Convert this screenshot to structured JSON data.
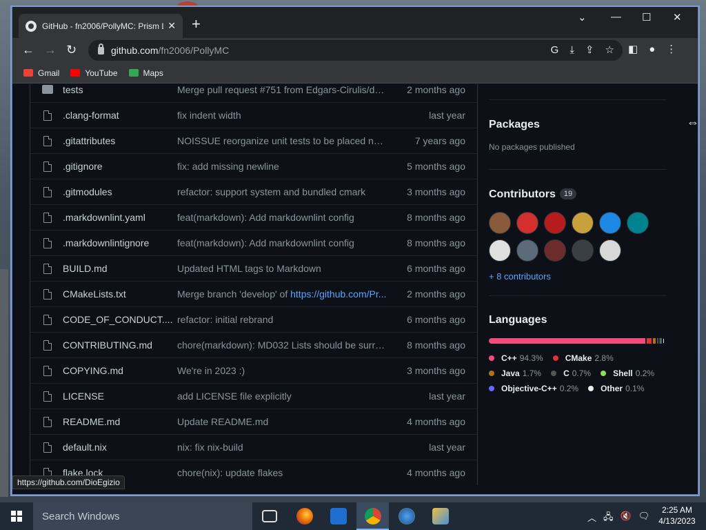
{
  "browser": {
    "tab_title": "GitHub - fn2006/PollyMC: Prism L",
    "tab_close": "✕",
    "new_tab": "+",
    "url_host": "github.com",
    "url_path": "/fn2006/PollyMC",
    "bookmarks": [
      {
        "label": "Gmail",
        "icon": "gmail-icon",
        "color": "#ea4335"
      },
      {
        "label": "YouTube",
        "icon": "youtube-icon",
        "color": "#ff0000"
      },
      {
        "label": "Maps",
        "icon": "maps-icon",
        "color": "#34a853"
      }
    ],
    "status_url": "https://github.com/DioEgizio"
  },
  "files": [
    {
      "type": "folder",
      "name": "tests",
      "message": "Merge pull request #751 from Edgars-Cirulis/dev...",
      "age": "2 months ago"
    },
    {
      "type": "file",
      "name": ".clang-format",
      "message": "fix indent width",
      "age": "last year"
    },
    {
      "type": "file",
      "name": ".gitattributes",
      "message": "NOISSUE reorganize unit tests to be placed next ...",
      "age": "7 years ago"
    },
    {
      "type": "file",
      "name": ".gitignore",
      "message": "fix: add missing newline",
      "age": "5 months ago"
    },
    {
      "type": "file",
      "name": ".gitmodules",
      "message": "refactor: support system and bundled cmark",
      "age": "3 months ago"
    },
    {
      "type": "file",
      "name": ".markdownlint.yaml",
      "message": "feat(markdown): Add markdownlint config",
      "age": "8 months ago"
    },
    {
      "type": "file",
      "name": ".markdownlintignore",
      "message": "feat(markdown): Add markdownlint config",
      "age": "8 months ago"
    },
    {
      "type": "file",
      "name": "BUILD.md",
      "message": "Updated HTML tags to Markdown",
      "age": "6 months ago"
    },
    {
      "type": "file",
      "name": "CMakeLists.txt",
      "message": "Merge branch 'develop' of ",
      "link": "https://github.com/Pr...",
      "age": "2 months ago"
    },
    {
      "type": "file",
      "name": "CODE_OF_CONDUCT....",
      "message": "refactor: initial rebrand",
      "age": "6 months ago"
    },
    {
      "type": "file",
      "name": "CONTRIBUTING.md",
      "message": "chore(markdown): MD032 Lists should be surrou...",
      "age": "8 months ago"
    },
    {
      "type": "file",
      "name": "COPYING.md",
      "message": "We're in 2023 :)",
      "age": "3 months ago"
    },
    {
      "type": "file",
      "name": "LICENSE",
      "message": "add LICENSE file explicitly",
      "age": "last year"
    },
    {
      "type": "file",
      "name": "README.md",
      "message": "Update README.md",
      "age": "4 months ago"
    },
    {
      "type": "file",
      "name": "default.nix",
      "message": "nix: fix nix-build",
      "age": "last year"
    },
    {
      "type": "file",
      "name": "flake.lock",
      "message": "chore(nix): update flakes",
      "age": "4 months ago"
    }
  ],
  "sidebar": {
    "packages_title": "Packages",
    "packages_empty": "No packages published",
    "contributors_title": "Contributors",
    "contributors_count": "19",
    "avatar_colors": [
      "#8a5a3c",
      "#d32f2f",
      "#b71c1c",
      "#c8a03c",
      "#1e88e5",
      "#00838f",
      "#e0e0e0",
      "#5c6b7a",
      "#6d2c2c",
      "#3a3f44",
      "#d8d8d8"
    ],
    "more_contributors": "+ 8 contributors",
    "languages_title": "Languages",
    "languages": [
      {
        "name": "C++",
        "pct": "94.3%",
        "share": 94.3,
        "color": "#f34b7d"
      },
      {
        "name": "CMake",
        "pct": "2.8%",
        "share": 2.8,
        "color": "#da3434"
      },
      {
        "name": "Java",
        "pct": "1.7%",
        "share": 1.7,
        "color": "#b07219"
      },
      {
        "name": "C",
        "pct": "0.7%",
        "share": 0.7,
        "color": "#555555"
      },
      {
        "name": "Shell",
        "pct": "0.2%",
        "share": 0.2,
        "color": "#89e051"
      },
      {
        "name": "Objective-C++",
        "pct": "0.2%",
        "share": 0.2,
        "color": "#6866fb"
      },
      {
        "name": "Other",
        "pct": "0.1%",
        "share": 0.1,
        "color": "#ededed"
      }
    ]
  },
  "taskbar": {
    "search_placeholder": "Search Windows",
    "time": "2:25 AM",
    "date": "4/13/2023"
  }
}
